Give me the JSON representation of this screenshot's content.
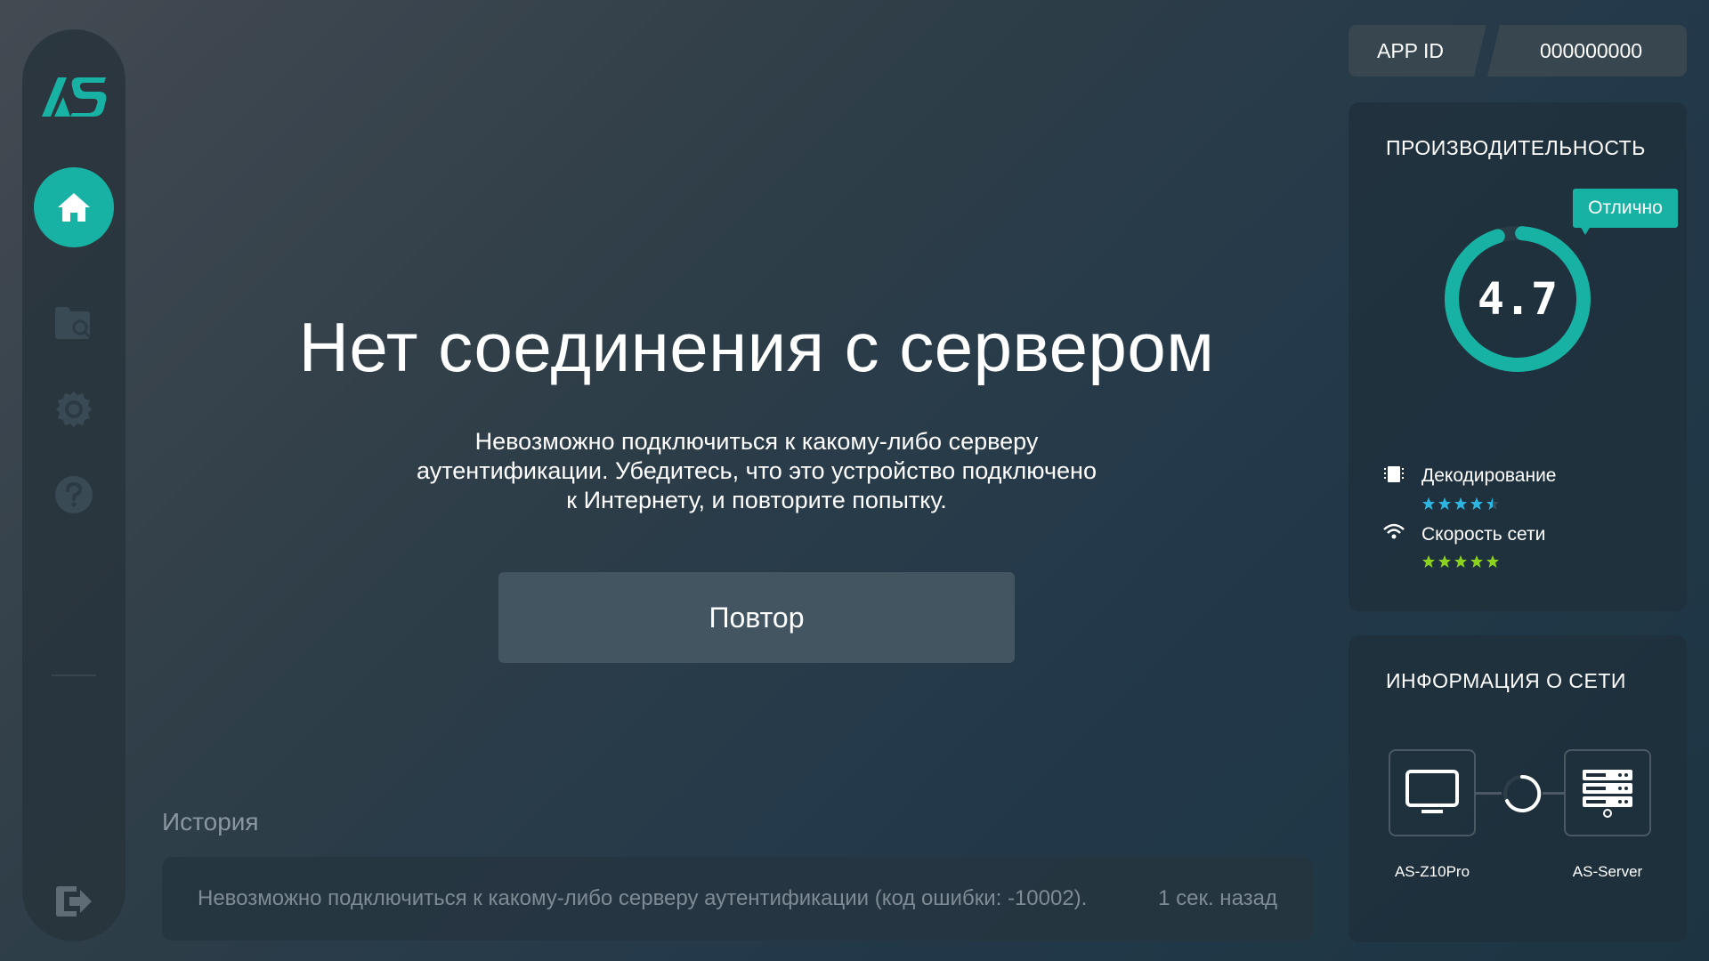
{
  "sidebar": {
    "logo_text": "AS",
    "items": [
      {
        "name": "home",
        "active": true
      },
      {
        "name": "search-folder"
      },
      {
        "name": "settings"
      },
      {
        "name": "help"
      }
    ],
    "logout": "logout"
  },
  "main": {
    "title": "Нет соединения с сервером",
    "message_lines": [
      "Невозможно подключиться к какому-либо серверу",
      "аутентификации. Убедитесь, что это устройство подключено",
      "к Интернету, и повторите попытку."
    ],
    "retry_label": "Повтор"
  },
  "history": {
    "title": "История",
    "entries": [
      {
        "text": "Невозможно подключиться к какому-либо серверу аутентификации (код ошибки: -10002).",
        "time": "1 сек. назад"
      }
    ]
  },
  "app_id": {
    "label": "APP ID",
    "value": "000000000"
  },
  "performance": {
    "title": "ПРОИЗВОДИТЕЛЬНОСТЬ",
    "badge": "Отлично",
    "score": "4.7",
    "score_fraction": 0.94,
    "metrics": [
      {
        "label": "Декодирование",
        "rating": 4.5,
        "star_color": "#2bb5e0"
      },
      {
        "label": "Скорость сети",
        "rating": 5,
        "star_color": "#8bd11e"
      }
    ]
  },
  "network": {
    "title": "ИНФОРМАЦИЯ О СЕТИ",
    "client_label": "AS-Z10Pro",
    "server_label": "AS-Server"
  },
  "colors": {
    "accent": "#18b2a4",
    "decode_stars": "#2bb5e0",
    "network_stars": "#8bd11e"
  }
}
